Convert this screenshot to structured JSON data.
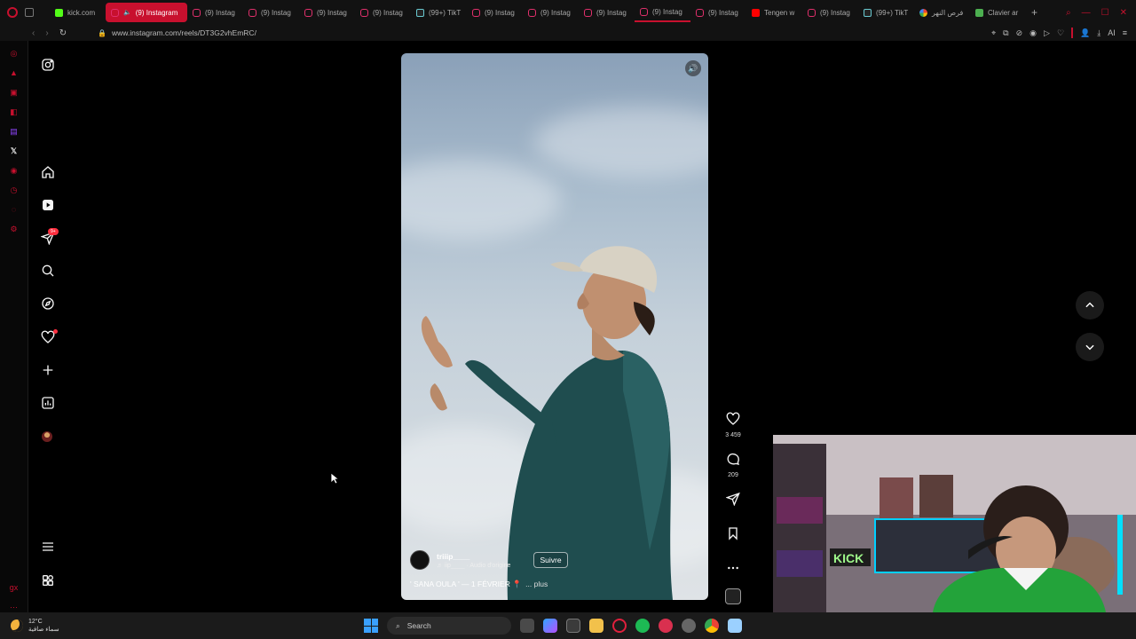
{
  "browser": {
    "tabs": [
      {
        "label": "kick.com",
        "favicon": "kick-icon",
        "active": false
      },
      {
        "label": "(9) Instagram",
        "favicon": "instagram-icon",
        "active": true,
        "muted": true
      },
      {
        "label": "(9) Instag",
        "favicon": "instagram-icon",
        "active": false
      },
      {
        "label": "(9) Instag",
        "favicon": "instagram-icon",
        "active": false
      },
      {
        "label": "(9) Instag",
        "favicon": "instagram-icon",
        "active": false
      },
      {
        "label": "(9) Instag",
        "favicon": "instagram-icon",
        "active": false
      },
      {
        "label": "(99+) TikT",
        "favicon": "tiktok-icon",
        "active": false
      },
      {
        "label": "(9) Instag",
        "favicon": "instagram-icon",
        "active": false
      },
      {
        "label": "(9) Instag",
        "favicon": "instagram-icon",
        "active": false
      },
      {
        "label": "(9) Instag",
        "favicon": "instagram-icon",
        "active": false
      },
      {
        "label": "(9) Instag",
        "favicon": "instagram-icon",
        "active": false,
        "underline": true
      },
      {
        "label": "(9) Instag",
        "favicon": "instagram-icon",
        "active": false
      },
      {
        "label": "Tengen w",
        "favicon": "youtube-icon",
        "active": false
      },
      {
        "label": "(9) Instag",
        "favicon": "instagram-icon",
        "active": false
      },
      {
        "label": "(99+) TikT",
        "favicon": "tiktok-icon",
        "active": false
      },
      {
        "label": "فرص النهر",
        "favicon": "google-icon",
        "active": false
      },
      {
        "label": "Clavier ar",
        "favicon": "letter-l-icon",
        "active": false
      }
    ],
    "url": "www.instagram.com/reels/DT3G2vhEmRC/"
  },
  "reel": {
    "username": "triiip____",
    "audio": "♬ iip____ · Audio d'origine",
    "follow_label": "Suivre",
    "caption": "' SANA OULA ' — 1 FÉVRIER 📍",
    "more_label": "... plus",
    "likes": "3 459",
    "comments": "209"
  },
  "taskbar": {
    "temperature": "12°C",
    "weather": "سماء صافية",
    "search_placeholder": "Search"
  },
  "colors": {
    "opera_red": "#c8102e",
    "notification_red": "#ff3040"
  },
  "ig_badge": "9+"
}
